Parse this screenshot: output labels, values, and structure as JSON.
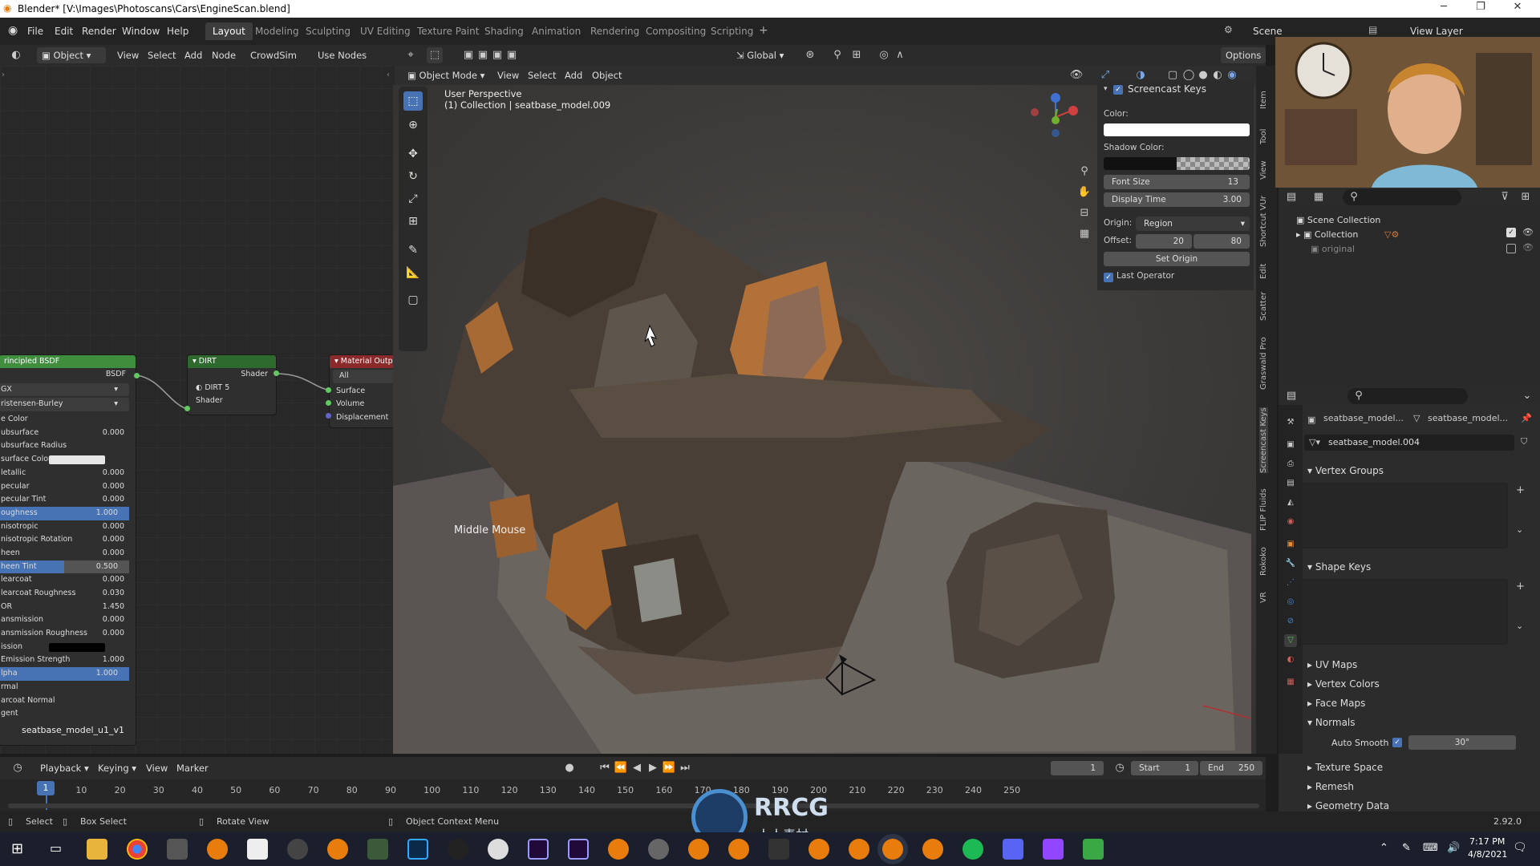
{
  "window": {
    "title": "Blender* [V:\\Images\\Photoscans\\Cars\\EngineScan.blend]"
  },
  "menu": [
    "File",
    "Edit",
    "Render",
    "Window",
    "Help"
  ],
  "workspaces": [
    "Layout",
    "Modeling",
    "Sculpting",
    "UV Editing",
    "Texture Paint",
    "Shading",
    "Animation",
    "Rendering",
    "Compositing",
    "Scripting"
  ],
  "scene": {
    "scene_label": "Scene",
    "view_layer_label": "View Layer"
  },
  "node_editor": {
    "header": {
      "object_label": "Object",
      "view": "View",
      "select": "Select",
      "add": "Add",
      "node": "Node",
      "crowdsim": "CrowdSim",
      "use_nodes": "Use Nodes"
    },
    "principled": {
      "title": "rincipled BSDF",
      "output": "BSDF",
      "dist": "GX",
      "sss": "ristensen-Burley",
      "rows": [
        {
          "label": "e Color",
          "value": "",
          "bar": false
        },
        {
          "label": "ubsurface",
          "value": "0.000",
          "bar": false
        },
        {
          "label": "ubsurface Radius",
          "value": "",
          "bar": false
        },
        {
          "label": "surface Color",
          "value": "",
          "bar": false
        },
        {
          "label": "letallic",
          "value": "0.000",
          "bar": false
        },
        {
          "label": "pecular",
          "value": "0.000",
          "bar": false
        },
        {
          "label": "pecular Tint",
          "value": "0.000",
          "bar": false
        },
        {
          "label": "oughness",
          "value": "1.000",
          "bar": true
        },
        {
          "label": "nisotropic",
          "value": "0.000",
          "bar": false
        },
        {
          "label": "nisotropic Rotation",
          "value": "0.000",
          "bar": false
        },
        {
          "label": "heen",
          "value": "0.000",
          "bar": false
        },
        {
          "label": "heen Tint",
          "value": "0.500",
          "bar": true
        },
        {
          "label": "learcoat",
          "value": "0.000",
          "bar": false
        },
        {
          "label": "learcoat Roughness",
          "value": "0.030",
          "bar": false
        },
        {
          "label": "OR",
          "value": "1.450",
          "bar": false
        },
        {
          "label": "ansmission",
          "value": "0.000",
          "bar": false
        },
        {
          "label": "ansmission Roughness",
          "value": "0.000",
          "bar": false
        },
        {
          "label": "ission",
          "value": "",
          "bar": false
        },
        {
          "label": "Emission Strength",
          "value": "1.000",
          "bar": false
        },
        {
          "label": "lpha",
          "value": "1.000",
          "bar": true
        },
        {
          "label": "rmal",
          "value": "",
          "bar": false
        },
        {
          "label": "arcoat Normal",
          "value": "",
          "bar": false
        },
        {
          "label": "gent",
          "value": "",
          "bar": false
        }
      ],
      "object_name": "seatbase_model_u1_v1"
    },
    "dirt": {
      "title": "DIRT",
      "output": "Shader",
      "field": "DIRT",
      "count": "5",
      "input": "Shader"
    },
    "material_output": {
      "title": "Material Outpu",
      "target": "All",
      "inputs": [
        "Surface",
        "Volume",
        "Displacement"
      ]
    }
  },
  "viewport": {
    "header": {
      "mode": "Object Mode",
      "view": "View",
      "select": "Select",
      "add": "Add",
      "object": "Object",
      "orientation": "Global",
      "options": "Options"
    },
    "overlay_title": "User Perspective",
    "overlay_sub": "(1) Collection | seatbase_model.009",
    "screencast_text": "Middle Mouse"
  },
  "screencast_panel": {
    "title": "Screencast Keys",
    "color_label": "Color:",
    "shadow_label": "Shadow Color:",
    "font_size_label": "Font Size",
    "font_size": "13",
    "display_time_label": "Display Time",
    "display_time": "3.00",
    "origin_label": "Origin:",
    "origin_value": "Region",
    "offset_label": "Offset:",
    "offset_x": "20",
    "offset_y": "80",
    "set_origin": "Set Origin",
    "last_operator": "Last Operator"
  },
  "sidebar_tabs": [
    "Item",
    "Tool",
    "View",
    "Shortcut VUr",
    "Edit",
    "Scatter",
    "Graswald Pro",
    "Screencast Keys",
    "FLIP Fluids",
    "Rokoko",
    "VR"
  ],
  "outliner": {
    "scene_collection": "Scene Collection",
    "collection": "Collection",
    "original": "original"
  },
  "properties": {
    "obj_name": "seatbase_model...",
    "data_name": "seatbase_model...",
    "mesh_name": "seatbase_model.004",
    "sections": {
      "vertex_groups": "Vertex Groups",
      "shape_keys": "Shape Keys",
      "uv_maps": "UV Maps",
      "vertex_colors": "Vertex Colors",
      "face_maps": "Face Maps",
      "normals": "Normals",
      "auto_smooth": "Auto Smooth",
      "auto_smooth_angle": "30°",
      "texture_space": "Texture Space",
      "remesh": "Remesh",
      "geometry_data": "Geometry Data"
    }
  },
  "timeline": {
    "playback": "Playback",
    "keying": "Keying",
    "view": "View",
    "marker": "Marker",
    "current_frame": "1",
    "start_label": "Start",
    "start": "1",
    "end_label": "End",
    "end": "250",
    "ticks": [
      "1",
      "10",
      "20",
      "30",
      "40",
      "50",
      "60",
      "70",
      "80",
      "90",
      "100",
      "110",
      "120",
      "130",
      "140",
      "150",
      "160",
      "170",
      "180",
      "190",
      "200",
      "210",
      "220",
      "230",
      "240",
      "250"
    ]
  },
  "status": {
    "select": "Select",
    "box_select": "Box Select",
    "rotate_view": "Rotate View",
    "context_menu": "Object Context Menu",
    "version": "2.92.0"
  },
  "taskbar": {
    "time": "7:17 PM",
    "date": "4/8/2021"
  },
  "watermark": {
    "logo": "RRCG",
    "sub": "人人素材"
  },
  "colors": {
    "accent": "#4772b3",
    "node_green": "#3e8e3e",
    "node_red": "#8b2a2a",
    "viewport_bg": "#3d3b39"
  }
}
